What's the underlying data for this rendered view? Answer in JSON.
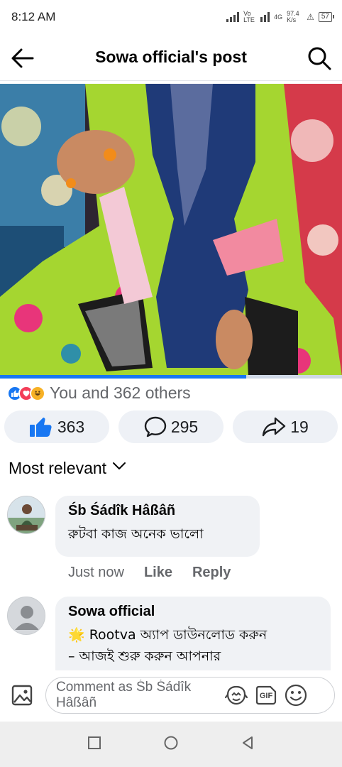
{
  "status_bar": {
    "time": "8:12 AM",
    "network_1": "Vo LTE",
    "network_2": "4G",
    "speed": "97.4 K/s",
    "battery": "57"
  },
  "header": {
    "title": "Sowa official's post",
    "back_icon": "arrow-left-icon",
    "search_icon": "search-icon"
  },
  "media": {
    "progress": 0.72
  },
  "reactions": {
    "icons": [
      "like-icon",
      "love-icon",
      "haha-icon"
    ],
    "summary": "You and 362 others"
  },
  "actions": {
    "likes": "363",
    "comments": "295",
    "shares": "19"
  },
  "sort": {
    "label": "Most relevant"
  },
  "comments": [
    {
      "author": "Śb Śádîk Hâßâñ",
      "text": "রুটবা  কাজ  অনেক ভালো",
      "time": "Just now",
      "like": "Like",
      "reply": "Reply"
    },
    {
      "author": "Sowa official",
      "text_line1": "🌟 Rootva অ্যাপ ডাউনলোড করুন",
      "text_line2": "– আজই শুরু করুন আপনার"
    }
  ],
  "composer": {
    "placeholder": "Comment as Śb Śádîk Hâßâñ",
    "gif_label": "GIF"
  },
  "colors": {
    "accent": "#1877f2",
    "muted_text": "#65676b",
    "bubble": "#f0f2f5"
  }
}
